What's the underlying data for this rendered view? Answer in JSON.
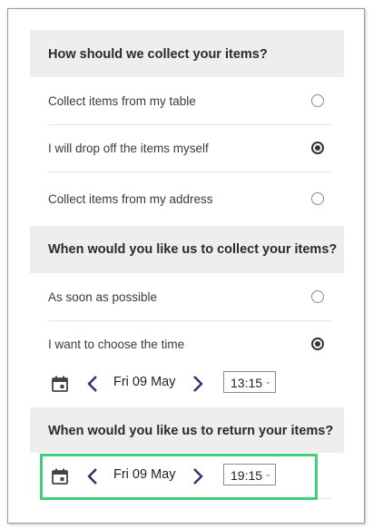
{
  "colors": {
    "header_bg": "#efeeec",
    "accent_icon": "#27336a",
    "highlight": "#3ed17a"
  },
  "collect_method": {
    "title": "How should we collect your items?",
    "options": [
      {
        "label": "Collect items from my table",
        "selected": false
      },
      {
        "label": "I will drop off the items myself",
        "selected": true
      },
      {
        "label": "Collect items from my address",
        "selected": false
      }
    ]
  },
  "collect_time": {
    "title": "When would you like us to collect your items?",
    "options": [
      {
        "label": "As soon as possible",
        "selected": false
      },
      {
        "label": "I want to choose the time",
        "selected": true
      }
    ],
    "picker": {
      "date": "Fri 09 May",
      "time": "13:15",
      "icon": "calendar-icon"
    }
  },
  "return_time": {
    "title": "When would you like us to return your items?",
    "picker": {
      "date": "Fri 09 May",
      "time": "19:15",
      "icon": "calendar-icon"
    }
  }
}
